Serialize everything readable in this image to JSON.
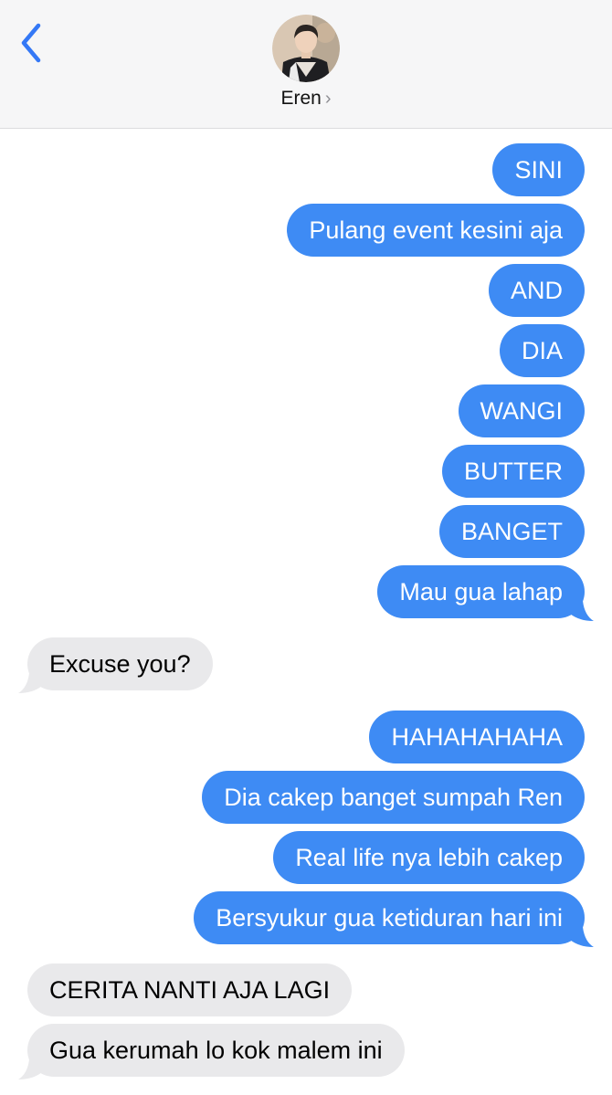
{
  "header": {
    "contact_name": "Eren",
    "chevron": "›",
    "back_icon": "chevron-left-icon",
    "accent_color": "#3478f6"
  },
  "messages": [
    {
      "from": "me",
      "text": "SINI"
    },
    {
      "from": "me",
      "text": "Pulang event kesini aja"
    },
    {
      "from": "me",
      "text": "AND"
    },
    {
      "from": "me",
      "text": "DIA"
    },
    {
      "from": "me",
      "text": "WANGI"
    },
    {
      "from": "me",
      "text": "BUTTER"
    },
    {
      "from": "me",
      "text": "BANGET"
    },
    {
      "from": "me",
      "text": "Mau gua lahap"
    },
    {
      "from": "them",
      "text": "Excuse you?"
    },
    {
      "from": "me",
      "text": "HAHAHAHAHA"
    },
    {
      "from": "me",
      "text": "Dia cakep banget sumpah Ren"
    },
    {
      "from": "me",
      "text": "Real life nya lebih cakep"
    },
    {
      "from": "me",
      "text": "Bersyukur gua ketiduran hari ini"
    },
    {
      "from": "them",
      "text": "CERITA NANTI AJA LAGI"
    },
    {
      "from": "them",
      "text": "Gua kerumah lo kok malem ini"
    }
  ],
  "colors": {
    "sent_bubble": "#3e8bf4",
    "received_bubble": "#e9e9eb",
    "header_bg": "#f6f6f7"
  }
}
